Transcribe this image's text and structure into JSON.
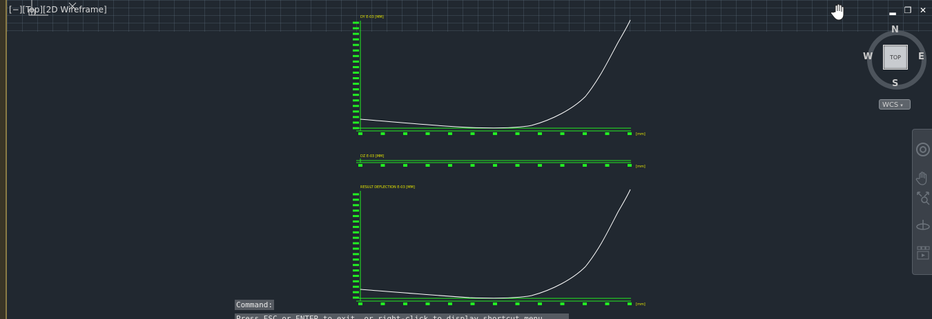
{
  "viewport": {
    "label": "[−][Top][2D Wireframe]"
  },
  "window_controls": {
    "minimize": "▂",
    "restore": "❐",
    "close": "✕"
  },
  "viewcube": {
    "face": "TOP",
    "north": "N",
    "south": "S",
    "east": "E",
    "west": "W"
  },
  "wcs": {
    "label": "WCS"
  },
  "icons": {
    "pan": "pan-hand-icon",
    "ucs": "ucs-axis-icon",
    "navbar": [
      "steering-wheel-icon",
      "pan-icon",
      "zoom-extents-icon",
      "orbit-icon",
      "showmotion-icon"
    ]
  },
  "colors": {
    "background": "#212830",
    "axis": "#22ee22",
    "curve": "#ffffff",
    "label": "#e6e600"
  },
  "graphs": [
    {
      "title": "DY E-03 [MM]",
      "unit": "[mm]"
    },
    {
      "title": "DZ E-03 [MM]",
      "unit": "[mm]"
    },
    {
      "title": "RESULT DEFLECTION E-03 [MM]",
      "unit": "[mm]"
    }
  ],
  "command": {
    "label": "Command:",
    "prompt": "Press ESC or ENTER to exit, or right-click to display shortcut menu."
  }
}
